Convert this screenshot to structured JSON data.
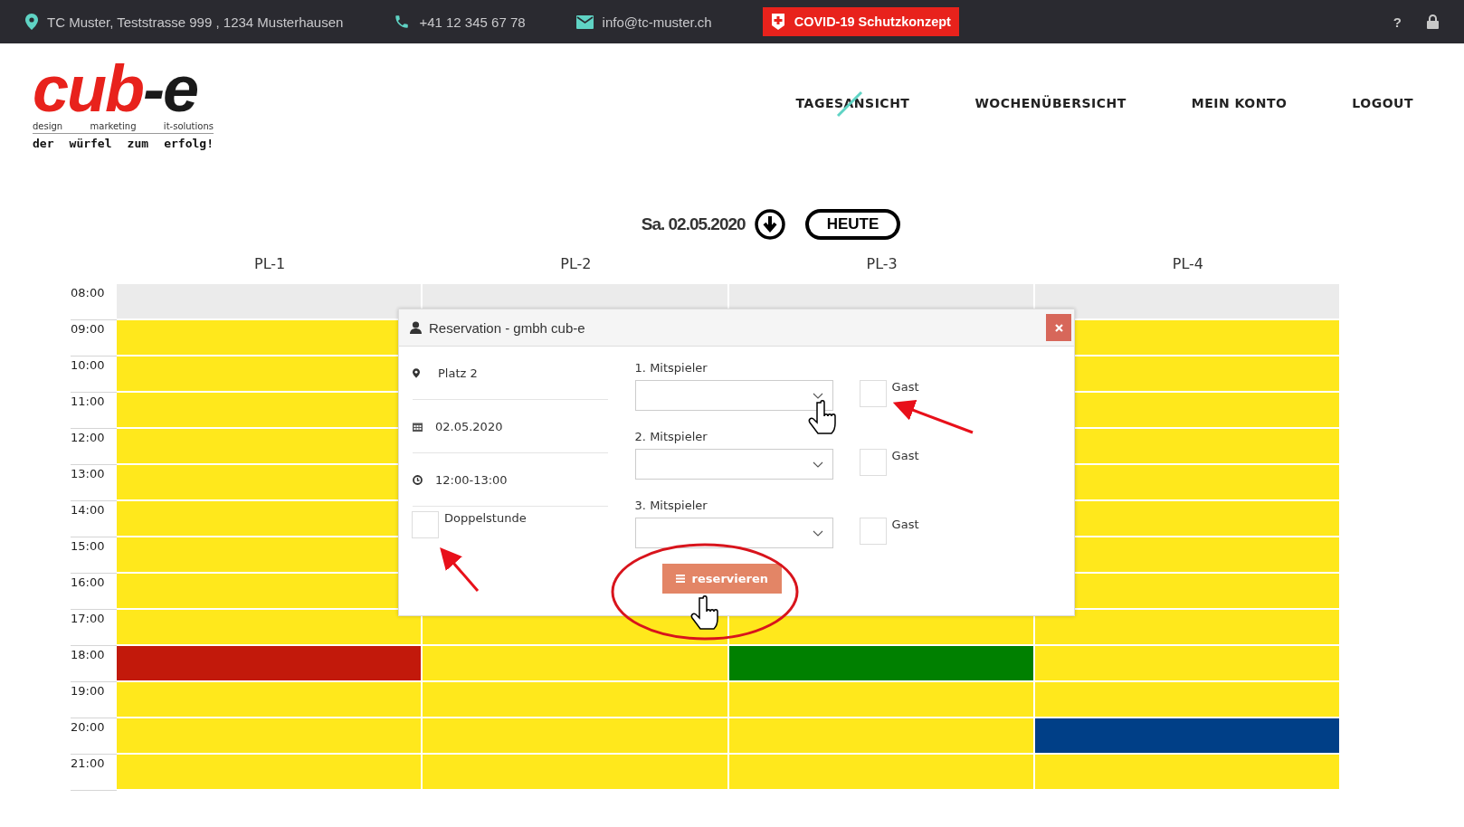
{
  "top_bar": {
    "address": "TC Muster, Teststrasse 999 , 1234 Musterhausen",
    "phone": "+41 12 345 67 78",
    "email": "info@tc-muster.ch",
    "covid_button": "COVID-19 Schutzkonzept",
    "help": "?"
  },
  "logo": {
    "wordmark_main": "cub",
    "wordmark_end": "-e",
    "services": [
      "design",
      "marketing",
      "it-solutions"
    ],
    "slogan": [
      "der",
      "würfel",
      "zum",
      "erfolg!"
    ]
  },
  "nav": [
    {
      "label": "TAGESANSICHT",
      "selected": true
    },
    {
      "label": "WOCHENÜBERSICHT",
      "selected": false
    },
    {
      "label": "MEIN KONTO",
      "selected": false
    },
    {
      "label": "LOGOUT",
      "selected": false
    }
  ],
  "date_bar": {
    "date": "Sa. 02.05.2020",
    "today_button": "HEUTE"
  },
  "schedule": {
    "courts": [
      "PL-1",
      "PL-2",
      "PL-3",
      "PL-4"
    ],
    "rows": [
      {
        "time": "08:00",
        "cells": [
          {
            "color": "#ebebeb"
          },
          {
            "color": "#ebebeb"
          },
          {
            "color": "#ebebeb"
          },
          {
            "color": "#ebebeb"
          }
        ]
      },
      {
        "time": "09:00",
        "cells": [
          {
            "color": "#ffe81c"
          },
          null,
          null,
          {
            "color": "#ffe81c"
          }
        ]
      },
      {
        "time": "10:00",
        "cells": [
          {
            "color": "#ffe81c"
          },
          null,
          null,
          {
            "color": "#ffe81c"
          }
        ]
      },
      {
        "time": "11:00",
        "cells": [
          {
            "color": "#ffe81c"
          },
          null,
          null,
          {
            "color": "#ffe81c"
          }
        ]
      },
      {
        "time": "12:00",
        "cells": [
          {
            "color": "#ffe81c"
          },
          null,
          null,
          {
            "color": "#ffe81c"
          }
        ]
      },
      {
        "time": "13:00",
        "cells": [
          {
            "color": "#ffe81c"
          },
          null,
          null,
          {
            "color": "#ffe81c"
          }
        ]
      },
      {
        "time": "14:00",
        "cells": [
          {
            "color": "#ffe81c"
          },
          null,
          null,
          {
            "color": "#ffe81c"
          }
        ]
      },
      {
        "time": "15:00",
        "cells": [
          {
            "color": "#ffe81c"
          },
          null,
          null,
          {
            "color": "#ffe81c"
          }
        ]
      },
      {
        "time": "16:00",
        "cells": [
          {
            "color": "#ffe81c"
          },
          null,
          null,
          {
            "color": "#ffe81c"
          }
        ]
      },
      {
        "time": "17:00",
        "cells": [
          {
            "color": "#ffe81c"
          },
          {
            "color": "#ffe81c"
          },
          {
            "color": "#ffe81c"
          },
          {
            "color": "#ffe81c"
          }
        ]
      },
      {
        "time": "18:00",
        "cells": [
          {
            "color": "#c2190b"
          },
          {
            "color": "#ffe81c"
          },
          {
            "color": "#008000"
          },
          {
            "color": "#ffe81c"
          }
        ]
      },
      {
        "time": "19:00",
        "cells": [
          {
            "color": "#ffe81c"
          },
          {
            "color": "#ffe81c"
          },
          {
            "color": "#ffe81c"
          },
          {
            "color": "#ffe81c"
          }
        ]
      },
      {
        "time": "20:00",
        "cells": [
          {
            "color": "#ffe81c"
          },
          {
            "color": "#ffe81c"
          },
          {
            "color": "#ffe81c"
          },
          {
            "color": "#003f87"
          }
        ]
      },
      {
        "time": "21:00",
        "cells": [
          {
            "color": "#ffe81c"
          },
          {
            "color": "#ffe81c"
          },
          {
            "color": "#ffe81c"
          },
          {
            "color": "#ffe81c"
          }
        ]
      }
    ]
  },
  "modal": {
    "title": "Reservation - gmbh cub-e",
    "location": "Platz 2",
    "date": "02.05.2020",
    "time": "12:00-13:00",
    "double_hour": {
      "label": "Doppelstunde",
      "checked": false
    },
    "players": [
      {
        "label": "1. Mitspieler",
        "guest_label": "Gast",
        "guest_checked": false
      },
      {
        "label": "2. Mitspieler",
        "guest_label": "Gast",
        "guest_checked": false
      },
      {
        "label": "3. Mitspieler",
        "guest_label": "Gast",
        "guest_checked": false
      }
    ],
    "submit_button": "reservieren"
  }
}
